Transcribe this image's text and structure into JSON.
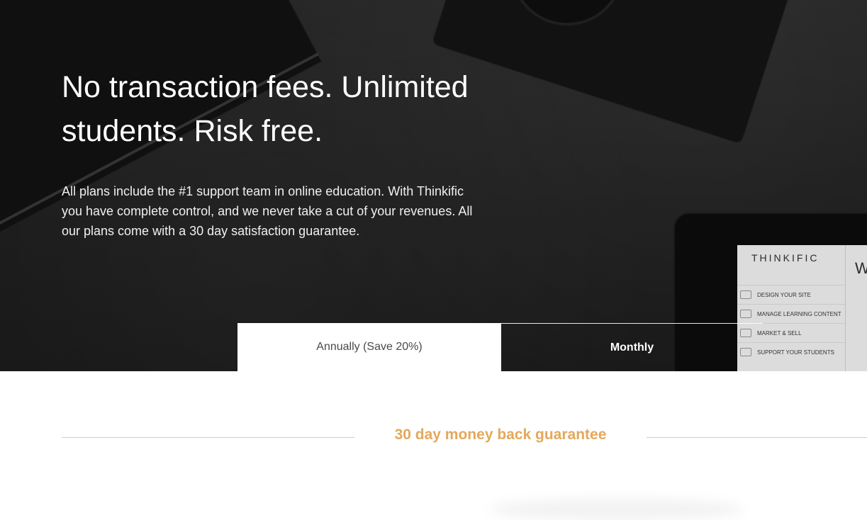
{
  "hero": {
    "headline": "No transaction fees. Unlimited students. Risk free.",
    "subtext": "All plans include the #1 support team in online education. With Thinkific you have complete control, and we never take a cut of your revenues. All our plans come with a 30 day satisfaction guarantee."
  },
  "billing_toggle": {
    "annual_label": "Annually (Save 20%)",
    "monthly_label": "Monthly",
    "selected": "annual"
  },
  "tablet_screen": {
    "brand": "THINKIFIC",
    "menu": [
      "DESIGN YOUR SITE",
      "MANAGE LEARNING CONTENT",
      "MARKET & SELL",
      "SUPPORT YOUR STUDENTS"
    ],
    "partial_text": "W"
  },
  "guarantee": {
    "text": "30 day money back guarantee"
  },
  "colors": {
    "accent_gold": "#e4a85b",
    "line_gold": "#e8c79a",
    "hero_dark": "#1b1b1b"
  }
}
